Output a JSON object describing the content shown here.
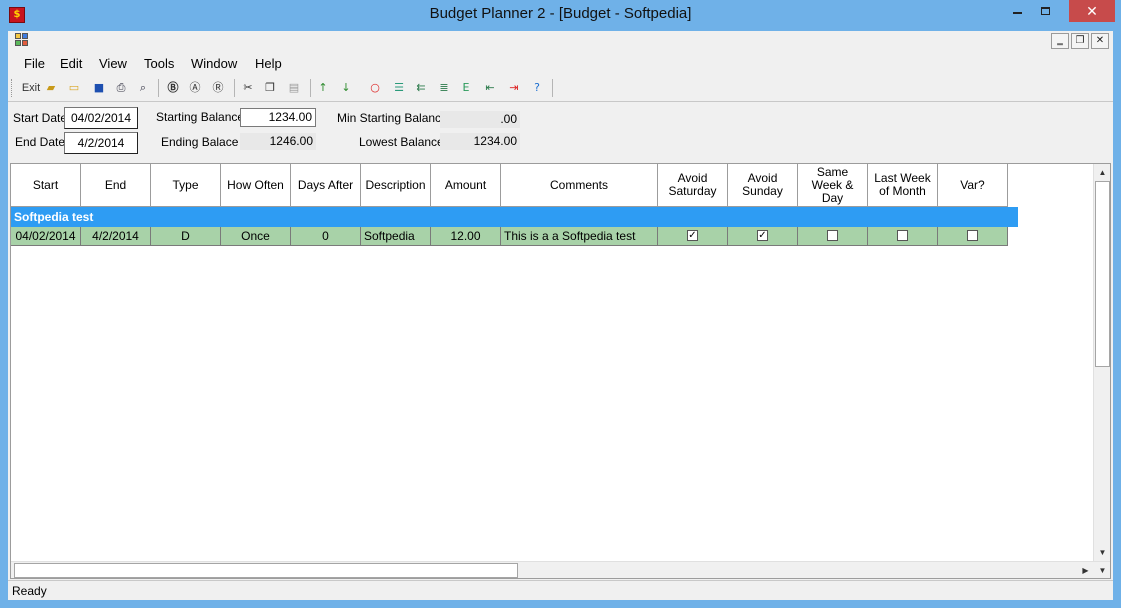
{
  "window": {
    "title": "Budget Planner 2 - [Budget - Softpedia]",
    "icon_glyph": "$"
  },
  "menu": [
    "File",
    "Edit",
    "View",
    "Tools",
    "Window",
    "Help"
  ],
  "toolbar": {
    "exit_label": "Exit",
    "icons": [
      "new-icon",
      "open-icon",
      "save-icon",
      "print-icon",
      "print-preview-icon",
      "bold-b-icon",
      "a-icon",
      "r-icon",
      "cut-icon",
      "copy-icon",
      "paste-icon",
      "up-arrow-icon",
      "down-arrow-icon",
      "circle-icon",
      "insert-row-icon",
      "indent-icon",
      "list-icon",
      "e-icon",
      "move-left-icon",
      "move-right-icon",
      "help-icon"
    ]
  },
  "form": {
    "start_date_label": "Start Date",
    "start_date": "04/02/2014",
    "end_date_label": "End Date",
    "end_date": "4/2/2014",
    "starting_balance_label": "Starting Balance",
    "starting_balance": "1234.00",
    "ending_balance_label": "Ending Balace",
    "ending_balance": "1246.00",
    "min_starting_balance_label": "Min Starting Balance",
    "min_starting_balance": ".00",
    "lowest_balance_label": "Lowest Balance",
    "lowest_balance": "1234.00"
  },
  "grid": {
    "columns": [
      "Start",
      "End",
      "Type",
      "How Often",
      "Days After",
      "Description",
      "Amount",
      "Comments",
      "Avoid Saturday",
      "Avoid Sunday",
      "Same Week & Day",
      "Last Week of Month",
      "Var?"
    ],
    "group_label": "Softpedia test",
    "rows": [
      {
        "start": "04/02/2014",
        "end": "4/2/2014",
        "type": "D",
        "how_often": "Once",
        "days_after": "0",
        "description": "Softpedia",
        "amount": "12.00",
        "comments": "This is a a Softpedia test",
        "avoid_saturday": true,
        "avoid_sunday": true,
        "same_week_day": false,
        "last_week_of_month": false,
        "var": false
      }
    ]
  },
  "status": {
    "text": "Ready"
  },
  "colors": {
    "titlebar": "#6fb1e8",
    "group_row": "#2e9cf3",
    "data_row": "#a8d2a8",
    "close_button": "#c74b4b"
  }
}
